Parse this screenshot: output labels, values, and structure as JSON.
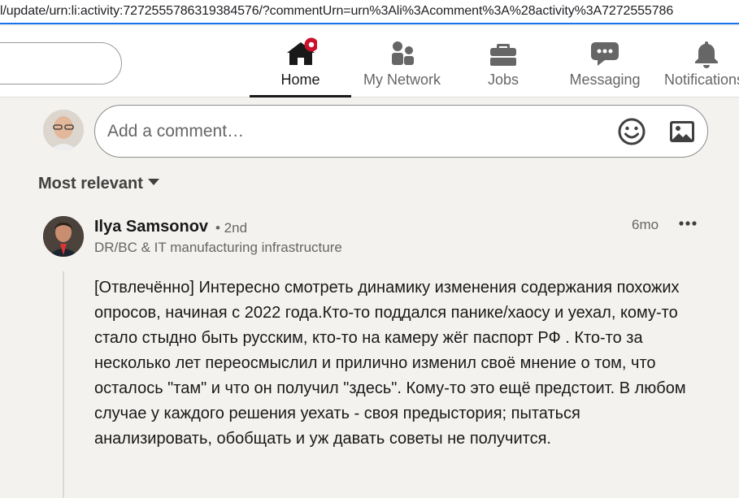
{
  "browser": {
    "url": "l/update/urn:li:activity:7272555786319384576/?commentUrn=urn%3Ali%3Acomment%3A%28activity%3A7272555786"
  },
  "nav": {
    "items": [
      {
        "label": "Home",
        "icon": "home-icon",
        "active": true
      },
      {
        "label": "My Network",
        "icon": "people-icon"
      },
      {
        "label": "Jobs",
        "icon": "briefcase-icon"
      },
      {
        "label": "Messaging",
        "icon": "chat-bubble-icon"
      },
      {
        "label": "Notifications",
        "icon": "bell-icon"
      }
    ]
  },
  "composer": {
    "placeholder": "Add a comment…",
    "emoji_icon": "smiley-icon",
    "image_icon": "image-icon"
  },
  "sort": {
    "label": "Most relevant"
  },
  "comment": {
    "author": "Ilya Samsonov",
    "degree": "• 2nd",
    "headline": "DR/BC & IT manufacturing infrastructure",
    "time": "6mo",
    "body": "[Отвлечённо] Интересно смотреть динамику изменения содержания похожих опросов, начиная с 2022 года.Кто-то поддался панике/хаосу и уехал, кому-то стало стыдно быть русским, кто-то на камеру жёг паспорт РФ . Кто-то за несколько лет переосмыслил и прилично изменил своё мнение о том, что осталось \"там\" и что он получил \"здесь\". Кому-то это ещё предстоит. В любом случае у каждого решения уехать - своя предыстория; пытаться анализировать, обобщать и уж давать советы не получится."
  },
  "colors": {
    "accent_active": "#191919",
    "notification_badge": "#cb112d",
    "text_secondary": "#666666",
    "url_focus": "#1a73e8"
  }
}
